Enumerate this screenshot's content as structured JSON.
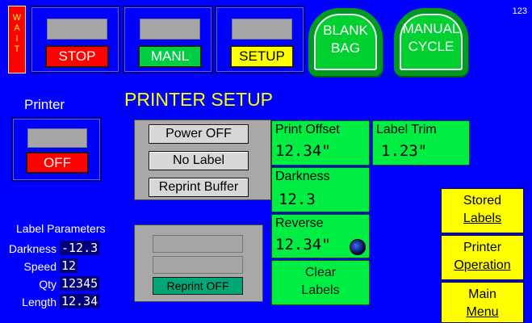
{
  "corner_number": "123",
  "wait": [
    "W",
    "A",
    "I",
    "T"
  ],
  "top": {
    "stop": "STOP",
    "manl": "MANL",
    "setup": "SETUP",
    "blank_bag": [
      "BLANK",
      "BAG"
    ],
    "manual_cycle": [
      "MANUAL",
      "CYCLE"
    ]
  },
  "title": "PRINTER SETUP",
  "printer": {
    "label": "Printer",
    "status": "OFF"
  },
  "controls": {
    "power_off": "Power OFF",
    "no_label": "No Label",
    "reprint_buffer": "Reprint Buffer"
  },
  "fields": {
    "print_offset": {
      "label": "Print Offset",
      "value": "12.34",
      "unit": "\""
    },
    "label_trim": {
      "label": "Label Trim",
      "value": "1.23",
      "unit": "\""
    },
    "darkness": {
      "label": "Darkness",
      "value": "12.3"
    },
    "reverse": {
      "label": "Reverse",
      "value": "12.34",
      "unit": "\""
    },
    "clear_labels": [
      "Clear",
      "Labels"
    ]
  },
  "label_parameters": {
    "title": "Label Parameters",
    "darkness": {
      "label": "Darkness",
      "value": "-12.3"
    },
    "speed": {
      "label": "Speed",
      "value": "12"
    },
    "qty": {
      "label": "Qty",
      "value": "12345"
    },
    "length": {
      "label": "Length",
      "value": "12.34"
    }
  },
  "reprint": {
    "status": "Reprint OFF"
  },
  "nav": {
    "stored_labels": [
      "Stored",
      "Labels"
    ],
    "printer_operation": [
      "Printer",
      "Operation"
    ],
    "main_menu": [
      "Main",
      "Menu"
    ]
  }
}
